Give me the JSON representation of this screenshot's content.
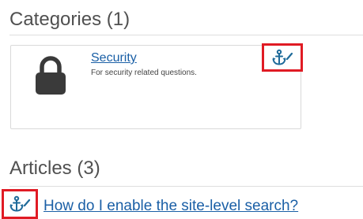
{
  "categories_section": {
    "heading": "Categories (1)",
    "items": [
      {
        "title": "Security",
        "description": "For security related questions.",
        "icon": "lock-icon",
        "action_icon": "anchor-edit-icon"
      }
    ]
  },
  "articles_section": {
    "heading": "Articles (3)",
    "items": [
      {
        "title": "How do I enable the site-level search?",
        "action_icon": "anchor-edit-icon"
      }
    ]
  },
  "colors": {
    "link": "#1a5fa6",
    "icon": "#1f6b9a",
    "highlight": "#e01b24",
    "lock": "#3a3a3a"
  }
}
